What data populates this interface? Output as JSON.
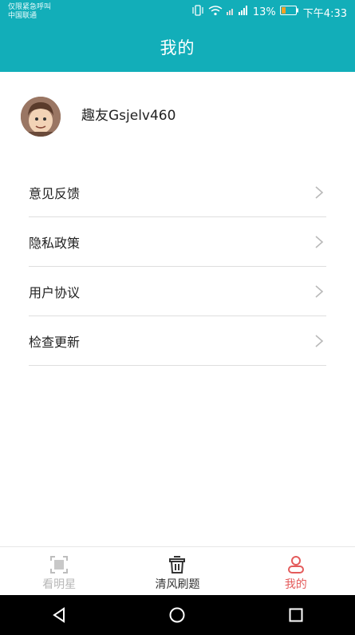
{
  "status_bar": {
    "emergency": "仅限紧急呼叫",
    "carrier": "中国联通",
    "battery_pct": "13%",
    "time": "下午4:33"
  },
  "header": {
    "title": "我的"
  },
  "profile": {
    "username": "趣友Gsjelv460"
  },
  "menu": [
    {
      "label": "意见反馈"
    },
    {
      "label": "隐私政策"
    },
    {
      "label": "用户协议"
    },
    {
      "label": "检查更新"
    }
  ],
  "tabs": [
    {
      "label": "看明星"
    },
    {
      "label": "清风刷题"
    },
    {
      "label": "我的"
    }
  ],
  "colors": {
    "primary": "#12aeb9",
    "active_tab": "#e45b5b"
  }
}
